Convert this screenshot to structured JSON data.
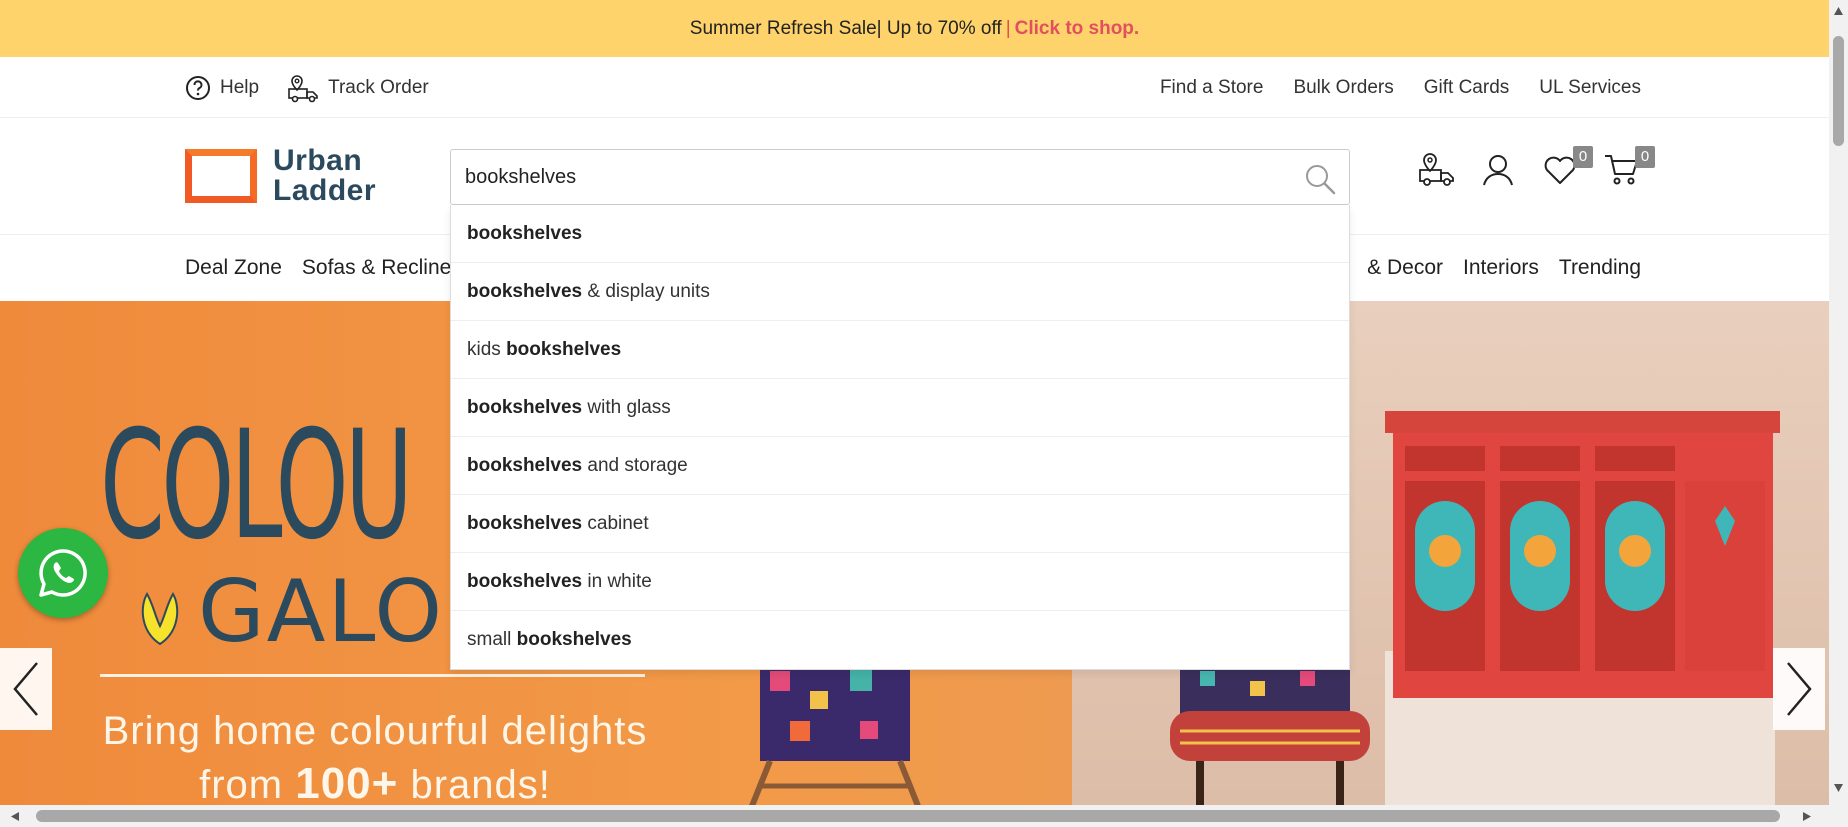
{
  "promo": {
    "text": "Summer Refresh Sale| Up to 70% off",
    "separator": "|",
    "cta": "Click to shop."
  },
  "utility": {
    "help": "Help",
    "track_order": "Track Order",
    "links": [
      "Find a Store",
      "Bulk Orders",
      "Gift Cards",
      "UL Services"
    ]
  },
  "logo": {
    "line1": "Urban",
    "line2": "Ladder"
  },
  "search": {
    "value": "bookshelves"
  },
  "header_icons": {
    "wishlist_count": "0",
    "cart_count": "0"
  },
  "nav": {
    "left": [
      "Deal Zone",
      "Sofas & Recline"
    ],
    "right": [
      "& Decor",
      "Interiors",
      "Trending"
    ]
  },
  "suggestions": [
    {
      "pre": "",
      "bold": "bookshelves",
      "post": ""
    },
    {
      "pre": "",
      "bold": "bookshelves",
      "post": " & display units"
    },
    {
      "pre": "kids ",
      "bold": "bookshelves",
      "post": ""
    },
    {
      "pre": "",
      "bold": "bookshelves",
      "post": " with glass"
    },
    {
      "pre": "",
      "bold": "bookshelves",
      "post": " and storage"
    },
    {
      "pre": "",
      "bold": "bookshelves",
      "post": " cabinet"
    },
    {
      "pre": "",
      "bold": "bookshelves",
      "post": " in white"
    },
    {
      "pre": "small ",
      "bold": "bookshelves",
      "post": ""
    }
  ],
  "banner": {
    "headline": "COLOU",
    "headline2": "GALOR",
    "tagline1": "Bring home colourful delights",
    "tagline2_pre": "from ",
    "tagline2_bold": "100+",
    "tagline2_post": " brands!"
  },
  "colors": {
    "promo_bg": "#ffd36b",
    "cta": "#e0505e",
    "brand_navy": "#2c4a5e",
    "brand_orange": "#f15a24",
    "whatsapp": "#2bb741"
  }
}
